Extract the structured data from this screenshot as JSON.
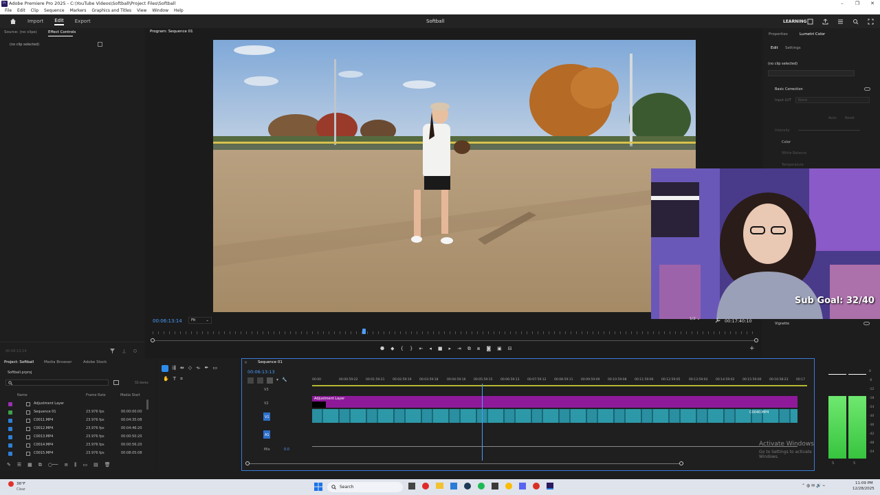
{
  "window": {
    "title": "Adobe Premiere Pro 2025 - C:\\YouTube Videos\\Softball\\Project Files\\Softball",
    "app_badge": "Pr",
    "controls": [
      "–",
      "❐",
      "✕"
    ]
  },
  "menubar": [
    "File",
    "Edit",
    "Clip",
    "Sequence",
    "Markers",
    "Graphics and Titles",
    "View",
    "Window",
    "Help"
  ],
  "header": {
    "workspaces": [
      "Import",
      "Edit",
      "Export"
    ],
    "active_workspace": "Edit",
    "document": "Softball",
    "learning": "LEARNING"
  },
  "source_panel": {
    "tabs": [
      "Source: (no clips)",
      "Effect Controls"
    ],
    "empty_text": "(no clip selected)",
    "timecode": "00:06:13:14"
  },
  "program_monitor": {
    "tab": "Program: Sequence 01",
    "timecode": "00:06:13:14",
    "fit": "Fit",
    "resolution": "1/2",
    "duration": "00:17:40:10"
  },
  "stream_overlay": {
    "sub_goal": "Sub Goal: 32/40"
  },
  "lumetri": {
    "tabs": [
      "Properties",
      "Lumetri Color"
    ],
    "subtabs": [
      "Edit",
      "Settings"
    ],
    "clip": "(no clip selected)",
    "section_basic": "Basic Correction",
    "input_lut_label": "Input LUT",
    "input_lut_value": "None",
    "auto": "Auto",
    "reset": "Reset",
    "intensity": "Intensity",
    "color": "Color",
    "white_balance": "White Balance",
    "temperature": "Temperature",
    "vignette": "Vignette"
  },
  "project_panel": {
    "tabs": [
      "Project: Softball",
      "Media Browser",
      "Adobe Stock"
    ],
    "file": "Softball.prproj",
    "items_count": "55 items",
    "columns": [
      "Name",
      "Frame Rate",
      "Media Start"
    ],
    "rows": [
      {
        "name": "Adjustment Layer",
        "rate": "",
        "start": "",
        "color": "#9b2fb5"
      },
      {
        "name": "Sequence 01",
        "rate": "23.976 fps",
        "start": "00:00:00:00",
        "color": "#3fa14a"
      },
      {
        "name": "C0011.MP4",
        "rate": "23.976 fps",
        "start": "00:04:35:08",
        "color": "#2e7fd6"
      },
      {
        "name": "C0012.MP4",
        "rate": "23.976 fps",
        "start": "00:04:46:20",
        "color": "#2e7fd6"
      },
      {
        "name": "C0013.MP4",
        "rate": "23.976 fps",
        "start": "00:00:50:20",
        "color": "#2e7fd6"
      },
      {
        "name": "C0014.MP4",
        "rate": "23.976 fps",
        "start": "00:00:56:20",
        "color": "#2e7fd6"
      },
      {
        "name": "C0015.MP4",
        "rate": "23.976 fps",
        "start": "00:08:05:08",
        "color": "#2e7fd6"
      }
    ]
  },
  "timeline": {
    "tab": "Sequence 01",
    "timecode": "00:06:13:13",
    "ruler": [
      "00:00",
      "00:00:59:22",
      "00:01:59:21",
      "00:02:59:19",
      "00:03:59:18",
      "00:04:59:16",
      "00:05:59:15",
      "00:06:59:13",
      "00:07:59:12",
      "00:08:59:11",
      "00:09:59:09",
      "00:10:59:08",
      "00:11:59:06",
      "00:12:59:05",
      "00:13:59:03",
      "00:14:59:02",
      "00:15:59:00",
      "00:16:58:23",
      "00:17"
    ],
    "tracks": [
      "V3",
      "V2",
      "V1",
      "A1",
      "Mix"
    ],
    "adjustment_clip": "Adjustment Layer",
    "clip_label_right": "C0040.MP4",
    "mix_value": "0.0"
  },
  "watermark": {
    "line1": "Activate Windows",
    "line2": "Go to Settings to activate Windows."
  },
  "audio_meter": {
    "scale": [
      "0",
      "-6",
      "-12",
      "-18",
      "-24",
      "-30",
      "-36",
      "-42",
      "-48",
      "-54"
    ],
    "channels": [
      "S",
      "S"
    ]
  },
  "taskbar": {
    "weather_temp": "36°F",
    "weather_desc": "Clear",
    "search": "Search",
    "time": "11:09 PM",
    "date": "12/28/2025"
  },
  "colors": {
    "accent_blue": "#2d8ceb",
    "adjustment_purple": "#8e1a9a",
    "video_teal": "#1f7a8c",
    "meter_green": "#3bdc4a"
  }
}
